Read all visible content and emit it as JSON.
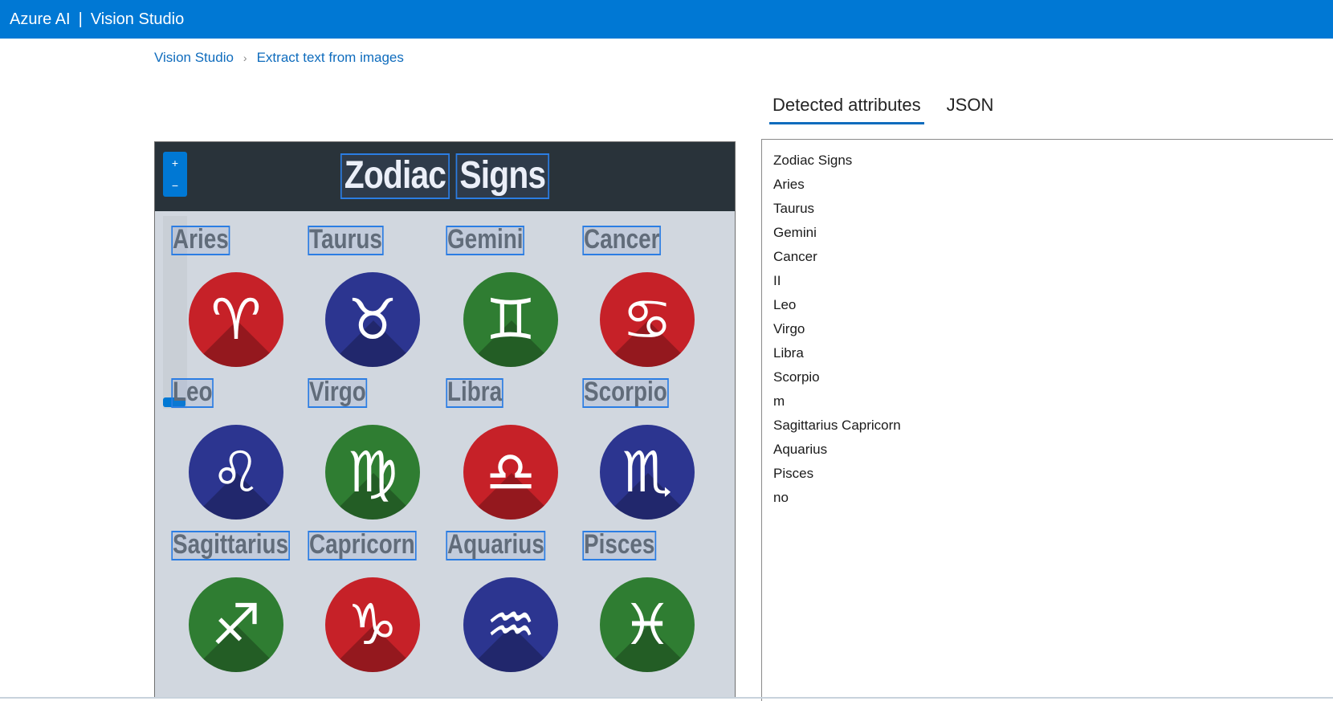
{
  "topbar": {
    "brand": "Azure AI",
    "separator": "|",
    "product": "Vision Studio",
    "color": "#0078d4"
  },
  "breadcrumb": {
    "home": "Vision Studio",
    "current": "Extract text from images"
  },
  "tabs": [
    {
      "label": "Detected attributes",
      "active": true
    },
    {
      "label": "JSON",
      "active": false
    }
  ],
  "zoom": {
    "in": "+",
    "out": "−"
  },
  "image": {
    "title_words": [
      "Zodiac",
      "Signs"
    ],
    "signs": [
      {
        "label": "Aries",
        "glyph": "♈",
        "color": "red"
      },
      {
        "label": "Taurus",
        "glyph": "♉",
        "color": "blue"
      },
      {
        "label": "Gemini",
        "glyph": "♊",
        "color": "green"
      },
      {
        "label": "Cancer",
        "glyph": "♋",
        "color": "red"
      },
      {
        "label": "Leo",
        "glyph": "♌",
        "color": "blue"
      },
      {
        "label": "Virgo",
        "glyph": "♍",
        "color": "green"
      },
      {
        "label": "Libra",
        "glyph": "♎",
        "color": "red"
      },
      {
        "label": "Scorpio",
        "glyph": "♏",
        "color": "blue"
      },
      {
        "label": "Sagittarius",
        "glyph": "♐",
        "color": "green"
      },
      {
        "label": "Capricorn",
        "glyph": "♑",
        "color": "red"
      },
      {
        "label": "Aquarius",
        "glyph": "♒",
        "color": "blue"
      },
      {
        "label": "Pisces",
        "glyph": "♓",
        "color": "green"
      }
    ]
  },
  "detected_attributes": [
    "Zodiac Signs",
    "Aries",
    "Taurus",
    "Gemini",
    "Cancer",
    "II",
    "Leo",
    "Virgo",
    "Libra",
    "Scorpio",
    "m",
    "Sagittarius Capricorn",
    "Aquarius",
    "Pisces",
    "no"
  ]
}
